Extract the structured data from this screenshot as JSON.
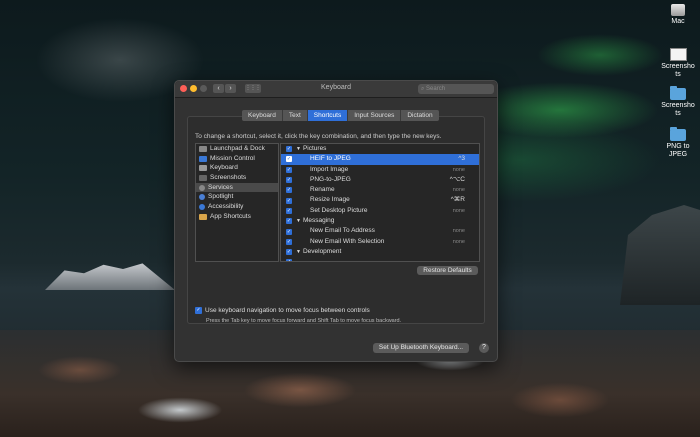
{
  "desktop": {
    "icons": [
      {
        "label": "Mac",
        "icon": "drive-icon"
      },
      {
        "label": "Screenshots",
        "icon": "screenshot-icon"
      },
      {
        "label": "Screenshots",
        "icon": "folder-icon"
      },
      {
        "label": "PNG to JPEG",
        "icon": "folder-icon"
      }
    ]
  },
  "window": {
    "title": "Keyboard",
    "search_placeholder": "Search",
    "back_glyph": "‹",
    "forward_glyph": "›",
    "grid_glyph": "⋮⋮⋮",
    "traffic": {
      "close": "#ff5f57",
      "minimize": "#febc2e",
      "zoom": "#5a5a5a"
    }
  },
  "tabs": [
    {
      "label": "Keyboard",
      "active": false
    },
    {
      "label": "Text",
      "active": false
    },
    {
      "label": "Shortcuts",
      "active": true
    },
    {
      "label": "Input Sources",
      "active": false
    },
    {
      "label": "Dictation",
      "active": false
    }
  ],
  "instructions": "To change a shortcut, select it, click the key combination, and then type the new keys.",
  "categories": [
    {
      "label": "Launchpad & Dock",
      "color": "#888"
    },
    {
      "label": "Mission Control",
      "color": "#3a78d6"
    },
    {
      "label": "Keyboard",
      "color": "#9a9a9a"
    },
    {
      "label": "Screenshots",
      "color": "#666"
    },
    {
      "label": "Services",
      "color": "#888"
    },
    {
      "label": "Spotlight",
      "color": "#4a7fd4"
    },
    {
      "label": "Accessibility",
      "color": "#3a78d6"
    },
    {
      "label": "App Shortcuts",
      "color": "#d9a54a"
    }
  ],
  "selected_category": "Services",
  "shortcuts": [
    {
      "label": "Pictures",
      "type": "group",
      "key": ""
    },
    {
      "label": "HEIF to JPEG",
      "type": "child",
      "key": "^3",
      "selected": true
    },
    {
      "label": "Import Image",
      "type": "child",
      "key": "none"
    },
    {
      "label": "PNG-to-JPEG",
      "type": "child",
      "key": "^⌥C",
      "set": true
    },
    {
      "label": "Rename",
      "type": "child",
      "key": "none"
    },
    {
      "label": "Resize Image",
      "type": "child",
      "key": "^⌘R",
      "set": true
    },
    {
      "label": "Set Desktop Picture",
      "type": "child",
      "key": "none"
    },
    {
      "label": "Messaging",
      "type": "group",
      "key": ""
    },
    {
      "label": "New Email To Address",
      "type": "child",
      "key": "none"
    },
    {
      "label": "New Email With Selection",
      "type": "child",
      "key": "none"
    },
    {
      "label": "Development",
      "type": "group",
      "key": ""
    },
    {
      "label": "",
      "type": "child",
      "key": ""
    }
  ],
  "restore_defaults": "Restore Defaults",
  "keyboard_nav": {
    "checked": true,
    "label": "Use keyboard navigation to move focus between controls",
    "hint": "Press the Tab key to move focus forward and Shift Tab to move focus backward."
  },
  "bluetooth_button": "Set Up Bluetooth Keyboard...",
  "help_label": "?"
}
